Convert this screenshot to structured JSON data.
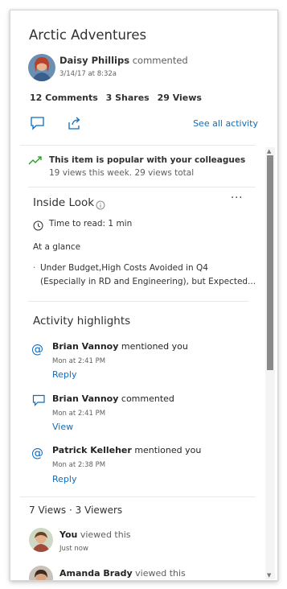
{
  "card": {
    "title": "Arctic Adventures",
    "author": {
      "name": "Daisy Phillips",
      "action": "commented",
      "date": "3/14/17 at 8:32a"
    },
    "stats": {
      "comments": "12 Comments",
      "shares": "3 Shares",
      "views": "29 Views"
    },
    "actions": {
      "see_all": "See all activity"
    },
    "popular": {
      "title": "This item is popular with your colleagues",
      "subtitle": "19 views this week. 29 views total"
    },
    "inside_look": {
      "title": "Inside Look",
      "more": "···",
      "time_to_read": "Time to read: 1 min",
      "at_a_glance": "At a glance",
      "bullet_line1": "Under Budget,High Costs Avoided in Q4",
      "bullet_line2": "(Especially in RD and Engineering), but Expected...",
      "bullet_marker": "·"
    },
    "activity": {
      "title": "Activity highlights",
      "items": [
        {
          "name": "Brian Vannoy",
          "action": "mentioned you",
          "time": "Mon at 2:41 PM",
          "link": "Reply",
          "icon": "at"
        },
        {
          "name": "Brian Vannoy",
          "action": "commented",
          "time": "Mon at 2:41 PM",
          "link": "View",
          "icon": "comment"
        },
        {
          "name": "Patrick Kelleher",
          "action": "mentioned you",
          "time": "Mon at 2:38 PM",
          "link": "Reply",
          "icon": "at"
        }
      ]
    },
    "views": {
      "summary_views": "7 Views",
      "separator": "·",
      "summary_viewers": "3 Viewers",
      "viewers": [
        {
          "name": "You",
          "action": "viewed this",
          "time": "Just now"
        },
        {
          "name": "Amanda Brady",
          "action": "viewed this"
        }
      ]
    }
  },
  "colors": {
    "accent": "#0f6cbd",
    "trend_green": "#13a10e",
    "text": "#323130",
    "muted": "#605e5c"
  }
}
